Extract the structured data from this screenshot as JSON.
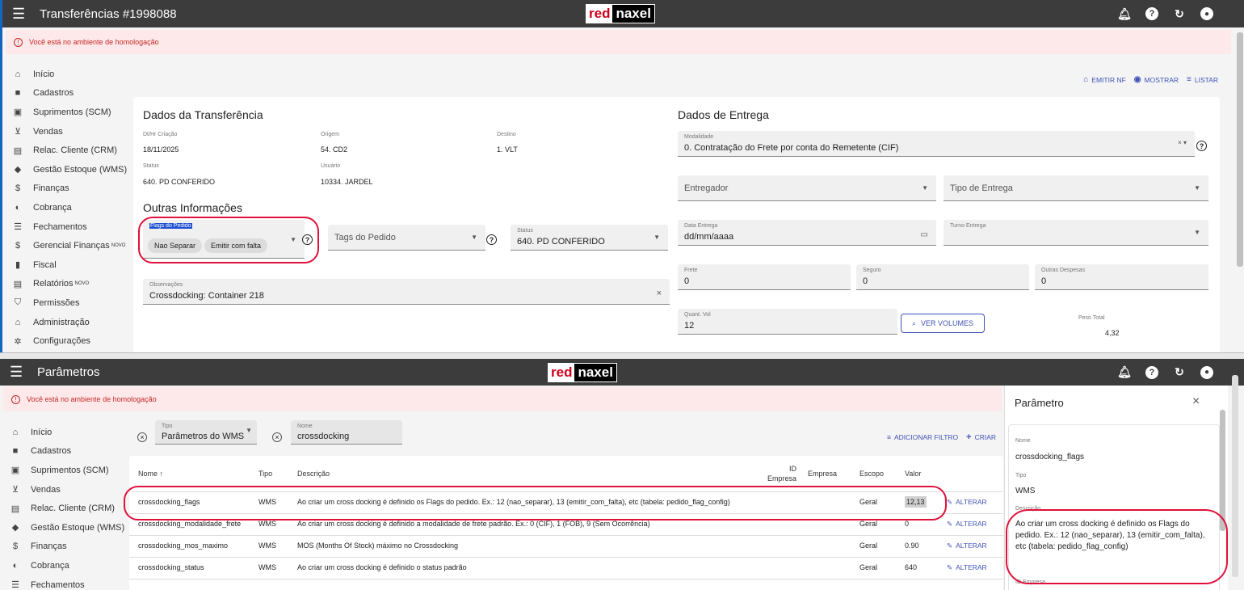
{
  "win1": {
    "title": "Transferências #1998088",
    "logo": {
      "red": "red",
      "black": "naxel"
    },
    "env_warning": "Você está no ambiente de homologação",
    "sidebar": [
      {
        "label": "Início",
        "icon": "home-icon",
        "glyph": "⌂"
      },
      {
        "label": "Cadastros",
        "icon": "folder-icon",
        "glyph": "■"
      },
      {
        "label": "Suprimentos (SCM)",
        "icon": "box-icon",
        "glyph": "▣"
      },
      {
        "label": "Vendas",
        "icon": "cart-icon",
        "glyph": "⊻"
      },
      {
        "label": "Relac. Cliente (CRM)",
        "icon": "contact-card-icon",
        "glyph": "▤"
      },
      {
        "label": "Gestão Estoque (WMS)",
        "icon": "diamond-icon",
        "glyph": "◆"
      },
      {
        "label": "Finanças",
        "icon": "money-icon",
        "glyph": "$"
      },
      {
        "label": "Cobrança",
        "icon": "coin-icon",
        "glyph": "◐"
      },
      {
        "label": "Fechamentos",
        "icon": "receipt-icon",
        "glyph": "☰"
      },
      {
        "label": "Gerencial Finanças",
        "sup": "NOVO",
        "icon": "money-icon",
        "glyph": "$"
      },
      {
        "label": "Fiscal",
        "icon": "document-icon",
        "glyph": "▮"
      },
      {
        "label": "Relatórios",
        "sup": "NOVO",
        "icon": "report-icon",
        "glyph": "▤"
      },
      {
        "label": "Permissões",
        "icon": "shield-icon",
        "glyph": "⛉"
      },
      {
        "label": "Administração",
        "icon": "bank-icon",
        "glyph": "⌂"
      },
      {
        "label": "Configurações",
        "icon": "gear-icon",
        "glyph": "✲"
      }
    ],
    "actions": {
      "emitir": "EMITIR NF",
      "mostrar": "MOSTRAR",
      "listar": "LISTAR"
    },
    "dados": {
      "heading": "Dados da Transferência",
      "dt_label": "Dt/Hr Criação",
      "dt_value": "18/11/2025",
      "origem_label": "Origem",
      "origem_value": "54. CD2",
      "destino_label": "Destino",
      "destino_value": "1. VLT",
      "status_label": "Status",
      "status_value": "640. PD CONFERIDO",
      "usuario_label": "Usuário",
      "usuario_value": "10334. JARDEL"
    },
    "outras": {
      "heading": "Outras Informações",
      "flags_label": "Flags do Pedido",
      "flags": [
        "Nao Separar",
        "Emitir com falta"
      ],
      "tags_placeholder": "Tags do Pedido",
      "status_label": "Status",
      "status_value": "640. PD CONFERIDO",
      "obs_label": "Observações",
      "obs_value": "Crossdocking: Container 218"
    },
    "entrega": {
      "heading": "Dados de Entrega",
      "modalidade_label": "Modalidade",
      "modalidade_value": "0. Contratação do Frete por conta do Remetente (CIF)",
      "entregador": "Entregador",
      "tipo_entrega": "Tipo de Entrega",
      "data_label": "Data Entrega",
      "data_value": "dd/mm/aaaa",
      "turno_label": "Turno Entrega",
      "frete_label": "Frete",
      "frete_value": "0",
      "seguro_label": "Seguro",
      "seguro_value": "0",
      "outras_label": "Outras Despesas",
      "outras_value": "0",
      "vol_label": "Quant. Vol",
      "vol_value": "12",
      "ver_volumes": "VER VOLUMES",
      "peso_label": "Peso Total",
      "peso_value": "4,32"
    }
  },
  "win2": {
    "title": "Parâmetros",
    "logo": {
      "red": "red",
      "black": "naxel"
    },
    "env_warning": "Você está no ambiente de homologação",
    "sidebar": [
      {
        "label": "Início",
        "icon": "home-icon",
        "glyph": "⌂"
      },
      {
        "label": "Cadastros",
        "icon": "folder-icon",
        "glyph": "■"
      },
      {
        "label": "Suprimentos (SCM)",
        "icon": "box-icon",
        "glyph": "▣"
      },
      {
        "label": "Vendas",
        "icon": "cart-icon",
        "glyph": "⊻"
      },
      {
        "label": "Relac. Cliente (CRM)",
        "icon": "contact-card-icon",
        "glyph": "▤"
      },
      {
        "label": "Gestão Estoque (WMS)",
        "icon": "diamond-icon",
        "glyph": "◆"
      },
      {
        "label": "Finanças",
        "icon": "money-icon",
        "glyph": "$"
      },
      {
        "label": "Cobrança",
        "icon": "coin-icon",
        "glyph": "◐"
      },
      {
        "label": "Fechamentos",
        "icon": "receipt-icon",
        "glyph": "☰"
      }
    ],
    "filters": {
      "tipo_label": "Tipo",
      "tipo_value": "Parâmetros do WMS",
      "nome_label": "Nome",
      "nome_value": "crossdocking",
      "add_filter": "ADICIONAR FILTRO",
      "criar": "CRIAR"
    },
    "table": {
      "headers": {
        "nome": "Nome",
        "tipo": "Tipo",
        "descricao": "Descrição",
        "id_empresa_1": "ID",
        "id_empresa_2": "Empresa",
        "empresa": "Empresa",
        "escopo": "Escopo",
        "valor": "Valor"
      },
      "action_label": "ALTERAR",
      "rows": [
        {
          "nome": "crossdocking_flags",
          "tipo": "WMS",
          "descricao": "Ao criar um cross docking é definido os Flags do pedido. Ex.: 12 (nao_separar), 13 (emitir_com_falta), etc (tabela: pedido_flag_config)",
          "escopo": "Geral",
          "valor": "12,13"
        },
        {
          "nome": "crossdocking_modalidade_frete",
          "tipo": "WMS",
          "descricao": "Ao criar um cross docking é definido a modalidade de frete padrão. Ex.: 0 (CIF), 1 (FOB), 9 (Sem Ocorrência)",
          "escopo": "Geral",
          "valor": "0"
        },
        {
          "nome": "crossdocking_mos_maximo",
          "tipo": "WMS",
          "descricao": "MOS (Months Of Stock) máximo no Crossdocking",
          "escopo": "Geral",
          "valor": "0.90"
        },
        {
          "nome": "crossdocking_status",
          "tipo": "WMS",
          "descricao": "Ao criar um cross docking é definido o status padrão",
          "escopo": "Geral",
          "valor": "640"
        }
      ]
    },
    "panel": {
      "title": "Parâmetro",
      "nome_label": "Nome",
      "nome_value": "crossdocking_flags",
      "tipo_label": "Tipo",
      "tipo_value": "WMS",
      "desc_label": "Descrição",
      "desc_value": "Ao criar um cross docking é definido os Flags do pedido. Ex.: 12 (nao_separar), 13 (emitir_com_falta), etc (tabela: pedido_flag_config)",
      "next_label": "ID Empresa"
    }
  },
  "colors": {
    "topbar": "#3c3c3c",
    "accent": "#3f51b5",
    "highlight": "#e0103a",
    "warning_bg": "#fde9e9",
    "warning_text": "#c62828"
  }
}
